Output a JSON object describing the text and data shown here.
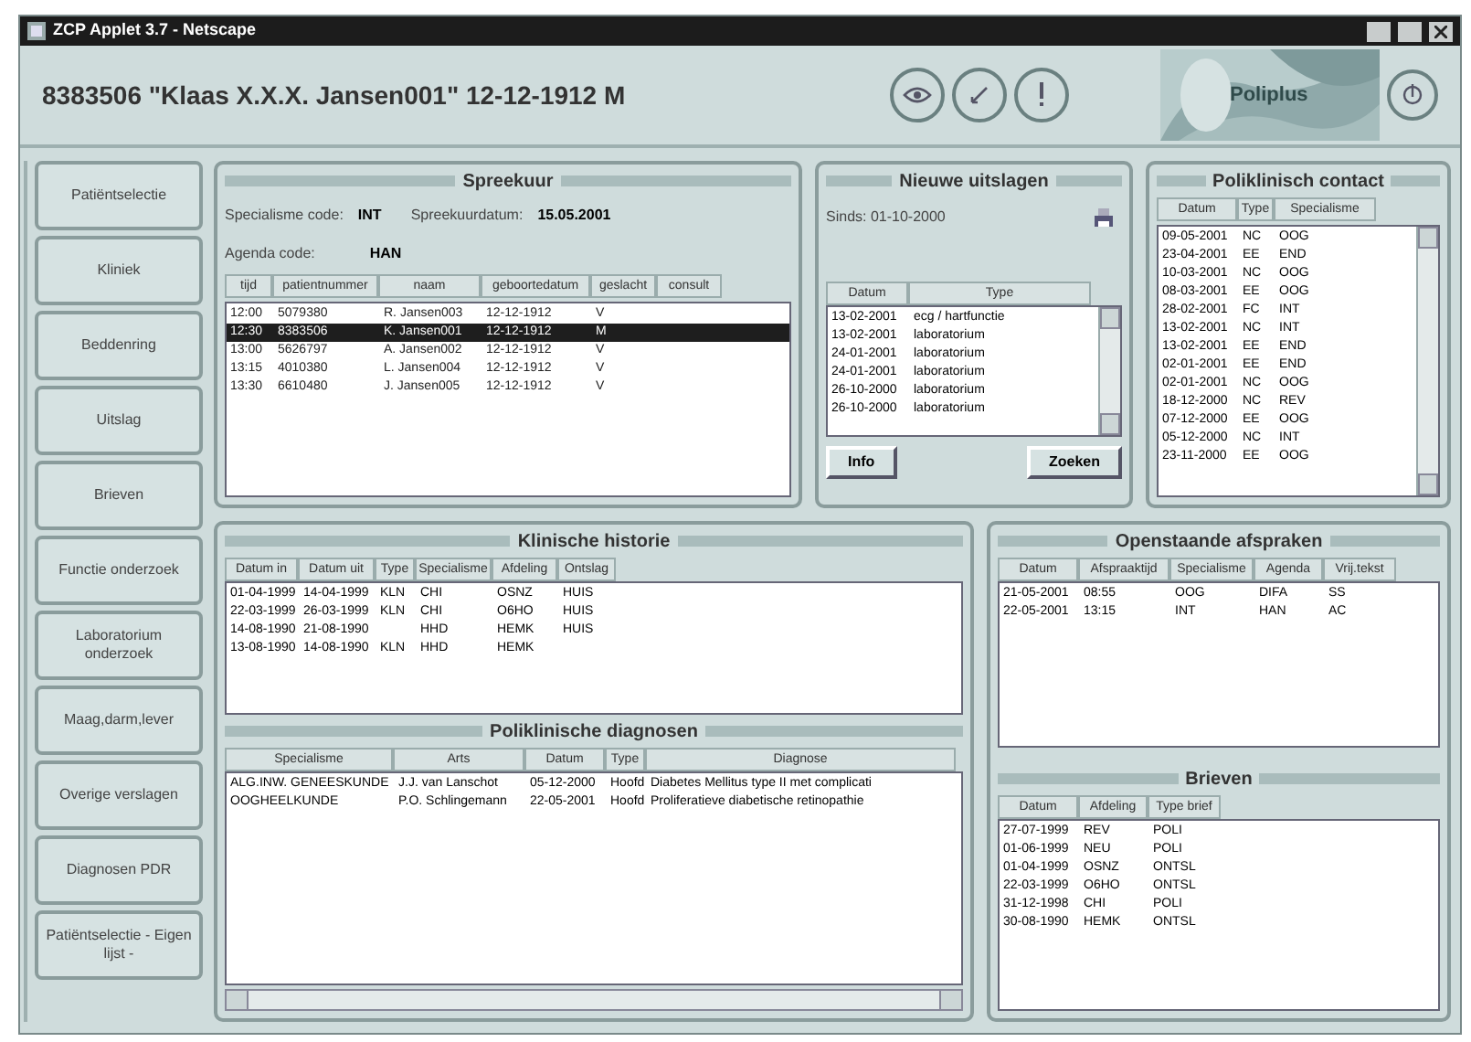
{
  "window": {
    "title": "ZCP Applet 3.7 - Netscape"
  },
  "patient": {
    "heading": "8383506 \"Klaas X.X.X. Jansen001\" 12-12-1912 M"
  },
  "logo": {
    "text": "Poliplus"
  },
  "sidebar": {
    "items": [
      {
        "label": "Patiëntselectie"
      },
      {
        "label": "Kliniek"
      },
      {
        "label": "Beddenring"
      },
      {
        "label": "Uitslag"
      },
      {
        "label": "Brieven"
      },
      {
        "label": "Functie onderzoek"
      },
      {
        "label": "Laboratorium onderzoek"
      },
      {
        "label": "Maag,darm,lever"
      },
      {
        "label": "Overige verslagen"
      },
      {
        "label": "Diagnosen PDR"
      },
      {
        "label": "Patiëntselectie - Eigen lijst -"
      }
    ]
  },
  "spreekuur": {
    "title": "Spreekuur",
    "fields": [
      {
        "label": "Specialisme code:",
        "value": "INT"
      },
      {
        "label": "Spreekuurdatum:",
        "value": "15.05.2001"
      },
      {
        "label": "Agenda code:",
        "value": "HAN"
      }
    ],
    "columns": [
      "tijd",
      "patientnummer",
      "naam",
      "geboortedatum",
      "geslacht",
      "consult"
    ],
    "rows": [
      {
        "cells": [
          "12:00",
          "5079380",
          "R. Jansen003",
          "12-12-1912",
          "V"
        ],
        "selected": false
      },
      {
        "cells": [
          "12:30",
          "8383506",
          "K. Jansen001",
          "12-12-1912",
          "M"
        ],
        "selected": true
      },
      {
        "cells": [
          "13:00",
          "5626797",
          "A. Jansen002",
          "12-12-1912",
          "V"
        ],
        "selected": false
      },
      {
        "cells": [
          "13:15",
          "4010380",
          "L. Jansen004",
          "12-12-1912",
          "V"
        ],
        "selected": false
      },
      {
        "cells": [
          "13:30",
          "6610480",
          "J. Jansen005",
          "12-12-1912",
          "V"
        ],
        "selected": false
      }
    ]
  },
  "nieuwe_uitslagen": {
    "title": "Nieuwe uitslagen",
    "since": "Sinds: 01-10-2000",
    "columns": [
      "Datum",
      "Type"
    ],
    "rows": [
      [
        "13-02-2001",
        "ecg / hartfunctie"
      ],
      [
        "13-02-2001",
        "laboratorium"
      ],
      [
        "24-01-2001",
        "laboratorium"
      ],
      [
        "24-01-2001",
        "laboratorium"
      ],
      [
        "26-10-2000",
        "laboratorium"
      ],
      [
        "26-10-2000",
        "laboratorium"
      ]
    ],
    "buttons": [
      "Info",
      "Zoeken"
    ]
  },
  "poliklinisch_contact": {
    "title": "Poliklinisch contact",
    "columns": [
      "Datum",
      "Type",
      "Specialisme"
    ],
    "rows": [
      [
        "09-05-2001",
        "NC",
        "OOG"
      ],
      [
        "23-04-2001",
        "EE",
        "END"
      ],
      [
        "10-03-2001",
        "NC",
        "OOG"
      ],
      [
        "08-03-2001",
        "EE",
        "OOG"
      ],
      [
        "28-02-2001",
        "FC",
        "INT"
      ],
      [
        "13-02-2001",
        "NC",
        "INT"
      ],
      [
        "13-02-2001",
        "EE",
        "END"
      ],
      [
        "02-01-2001",
        "EE",
        "END"
      ],
      [
        "02-01-2001",
        "NC",
        "OOG"
      ],
      [
        "18-12-2000",
        "NC",
        "REV"
      ],
      [
        "07-12-2000",
        "EE",
        "OOG"
      ],
      [
        "05-12-2000",
        "NC",
        "INT"
      ],
      [
        "23-11-2000",
        "EE",
        "OOG"
      ]
    ]
  },
  "klinische_historie": {
    "title": "Klinische historie",
    "columns": [
      "Datum in",
      "Datum uit",
      "Type",
      "Specialisme",
      "Afdeling",
      "Ontslag"
    ],
    "rows": [
      [
        "01-04-1999",
        "14-04-1999",
        "KLN",
        "CHI",
        "OSNZ",
        "HUIS"
      ],
      [
        "22-03-1999",
        "26-03-1999",
        "KLN",
        "CHI",
        "O6HO",
        "HUIS"
      ],
      [
        "14-08-1990",
        "21-08-1990",
        "",
        "HHD",
        "HEMK",
        "HUIS"
      ],
      [
        "13-08-1990",
        "14-08-1990",
        "KLN",
        "HHD",
        "HEMK",
        ""
      ]
    ]
  },
  "poliklinische_diagnosen": {
    "title": "Poliklinische diagnosen",
    "columns": [
      "Specialisme",
      "Arts",
      "Datum",
      "Type",
      "Diagnose"
    ],
    "rows": [
      [
        "ALG.INW. GENEESKUNDE",
        "J.J. van Lanschot",
        "05-12-2000",
        "Hoofd",
        "Diabetes Mellitus type II met complicati"
      ],
      [
        "OOGHEELKUNDE",
        "P.O. Schlingemann",
        "22-05-2001",
        "Hoofd",
        "Proliferatieve diabetische retinopathie"
      ]
    ]
  },
  "openstaande_afspraken": {
    "title": "Openstaande afspraken",
    "columns": [
      "Datum",
      "Afspraaktijd",
      "Specialisme",
      "Agenda",
      "Vrij.tekst"
    ],
    "rows": [
      [
        "21-05-2001",
        "08:55",
        "OOG",
        "DIFA",
        "SS"
      ],
      [
        "22-05-2001",
        "13:15",
        "INT",
        "HAN",
        "AC"
      ]
    ]
  },
  "brieven": {
    "title": "Brieven",
    "columns": [
      "Datum",
      "Afdeling",
      "Type brief"
    ],
    "rows": [
      [
        "27-07-1999",
        "REV",
        "POLI"
      ],
      [
        "01-06-1999",
        "NEU",
        "POLI"
      ],
      [
        "01-04-1999",
        "OSNZ",
        "ONTSL"
      ],
      [
        "22-03-1999",
        "O6HO",
        "ONTSL"
      ],
      [
        "31-12-1998",
        "CHI",
        "POLI"
      ],
      [
        "30-08-1990",
        "HEMK",
        "ONTSL"
      ]
    ]
  }
}
